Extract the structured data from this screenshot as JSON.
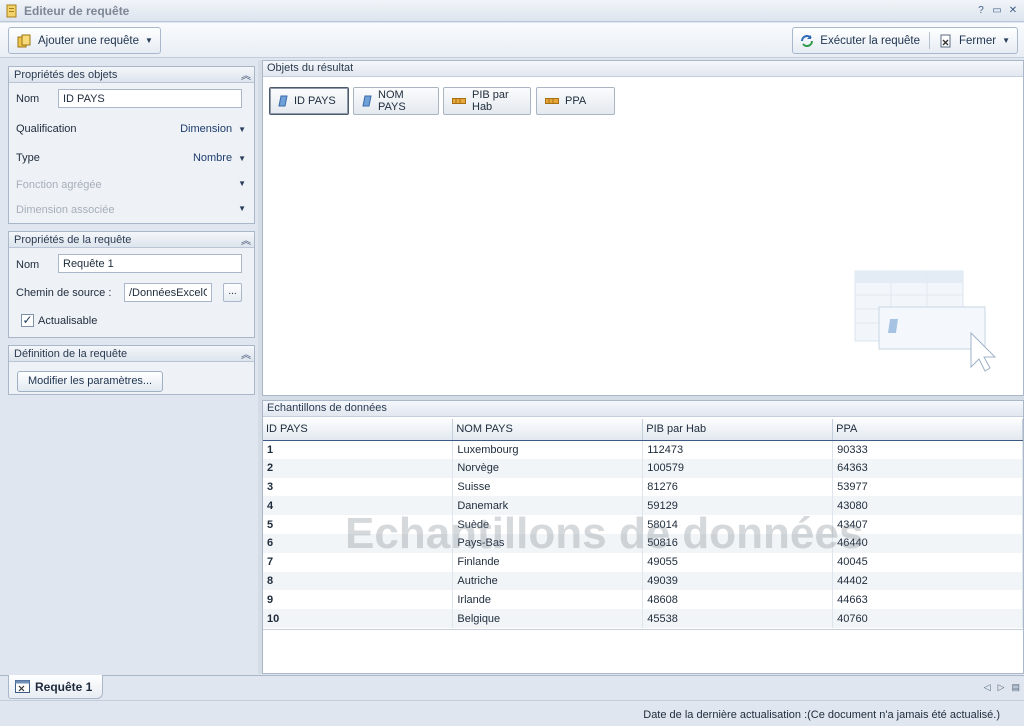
{
  "window": {
    "title": "Editeur de requête"
  },
  "toolbar": {
    "add_query_label": "Ajouter une requête",
    "run_query_label": "Exécuter la requête",
    "close_label": "Fermer"
  },
  "object_properties": {
    "title": "Propriétés des objets",
    "name_label": "Nom",
    "name_value": "ID PAYS",
    "qualification_label": "Qualification",
    "qualification_value": "Dimension",
    "type_label": "Type",
    "type_value": "Nombre",
    "aggregate_label": "Fonction agrégée",
    "associated_dim_label": "Dimension associée"
  },
  "query_properties": {
    "title": "Propriétés de la requête",
    "name_label": "Nom",
    "name_value": "Requête 1",
    "source_label": "Chemin de source :",
    "source_value": "/DonnéesExcelG",
    "browse_label": "...",
    "refreshable_label": "Actualisable"
  },
  "query_definition": {
    "title": "Définition de la requête",
    "modify_button_label": "Modifier les paramètres..."
  },
  "result_objects": {
    "title": "Objets du résultat",
    "items": [
      {
        "label": "ID PAYS",
        "kind": "dimension",
        "selected": true
      },
      {
        "label": "NOM PAYS",
        "kind": "dimension",
        "selected": false
      },
      {
        "label": "PIB par Hab",
        "kind": "measure",
        "selected": false
      },
      {
        "label": "PPA",
        "kind": "measure",
        "selected": false
      }
    ]
  },
  "samples": {
    "title": "Echantillons de données",
    "watermark": "Echantillons de données",
    "columns": [
      "ID PAYS",
      "NOM PAYS",
      "PIB par Hab",
      "PPA"
    ],
    "rows": [
      [
        "1",
        "Luxembourg",
        "112473",
        "90333"
      ],
      [
        "2",
        "Norvège",
        "100579",
        "64363"
      ],
      [
        "3",
        "Suisse",
        "81276",
        "53977"
      ],
      [
        "4",
        "Danemark",
        "59129",
        "43080"
      ],
      [
        "5",
        "Suède",
        "58014",
        "43407"
      ],
      [
        "6",
        "Pays-Bas",
        "50816",
        "46440"
      ],
      [
        "7",
        "Finlande",
        "49055",
        "40045"
      ],
      [
        "8",
        "Autriche",
        "49039",
        "44402"
      ],
      [
        "9",
        "Irlande",
        "48608",
        "44663"
      ],
      [
        "10",
        "Belgique",
        "45538",
        "40760"
      ]
    ]
  },
  "tabs": [
    {
      "label": "Requête 1"
    }
  ],
  "status": {
    "text": "Date de la dernière actualisation :(Ce document n'a jamais été actualisé.)"
  },
  "colors": {
    "accent": "#3c5b84",
    "panel_bg": "#eef2f7",
    "dimension_icon": "#6fa0d8",
    "measure_icon": "#e6a83a"
  }
}
